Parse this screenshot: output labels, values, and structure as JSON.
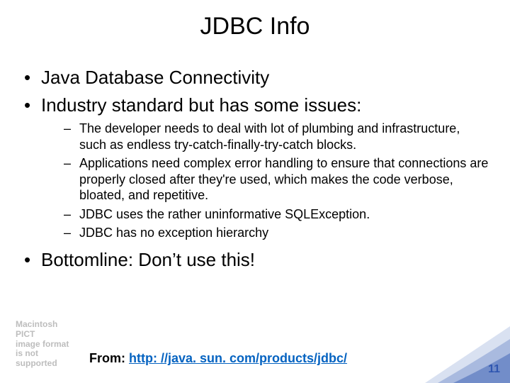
{
  "title": "JDBC Info",
  "bullets": {
    "b1": "Java Database Connectivity",
    "b2": "Industry standard but has some issues:",
    "sub1": "The developer needs to deal with lot of plumbing and infrastructure, such as endless try-catch-finally-try-catch blocks.",
    "sub2": "Applications need complex error handling to ensure that connections are properly closed after they're used, which makes the code verbose, bloated, and repetitive.",
    "sub3": "JDBC uses the rather uninformative SQLException.",
    "sub4": "JDBC has no exception hierarchy",
    "b3": "Bottomline: Don’t use this!"
  },
  "placeholder": {
    "l1": "Macintosh PICT",
    "l2": "image format",
    "l3": "is not supported"
  },
  "source": {
    "label": "From: ",
    "url_text": "http: //java. sun. com/products/jdbc/"
  },
  "page_number": "11"
}
